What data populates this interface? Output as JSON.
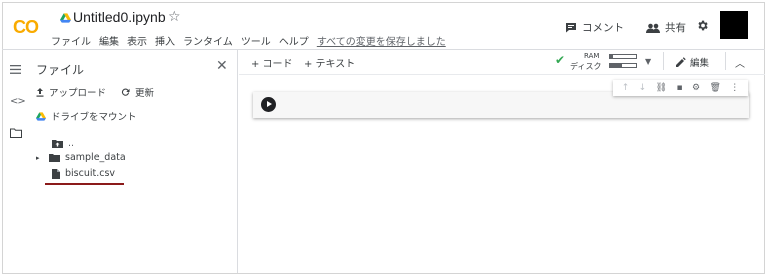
{
  "app": {
    "logo": "CO",
    "notebook_title": "Untitled0.ipynb"
  },
  "menu": {
    "items": [
      "ファイル",
      "編集",
      "表示",
      "挿入",
      "ランタイム",
      "ツール",
      "ヘルプ"
    ],
    "saved_status": "すべての変更を保存しました"
  },
  "header": {
    "comment_label": "コメント",
    "share_label": "共有"
  },
  "sidebar": {
    "title": "ファイル",
    "upload_label": "アップロード",
    "refresh_label": "更新",
    "mount_label": "ドライブをマウント",
    "tree": {
      "parent": "..",
      "folder": "sample_data",
      "file": "biscuit.csv"
    }
  },
  "toolbar": {
    "add_code": "+ コード",
    "add_text": "+ テキスト",
    "ram_label": "RAM",
    "disk_label": "ディスク",
    "edit_label": "編集"
  },
  "resources": {
    "ram_usage": 0.1,
    "disk_usage": 0.45
  },
  "icons": {
    "drive": "google-drive-icon",
    "star": "star-icon",
    "comment": "comment-icon",
    "share": "people-icon",
    "settings": "gear-icon",
    "run": "play-icon"
  },
  "colors": {
    "logo": "#f9ab00",
    "check": "#34a853",
    "annotation_underline": "#8b1a1a"
  }
}
